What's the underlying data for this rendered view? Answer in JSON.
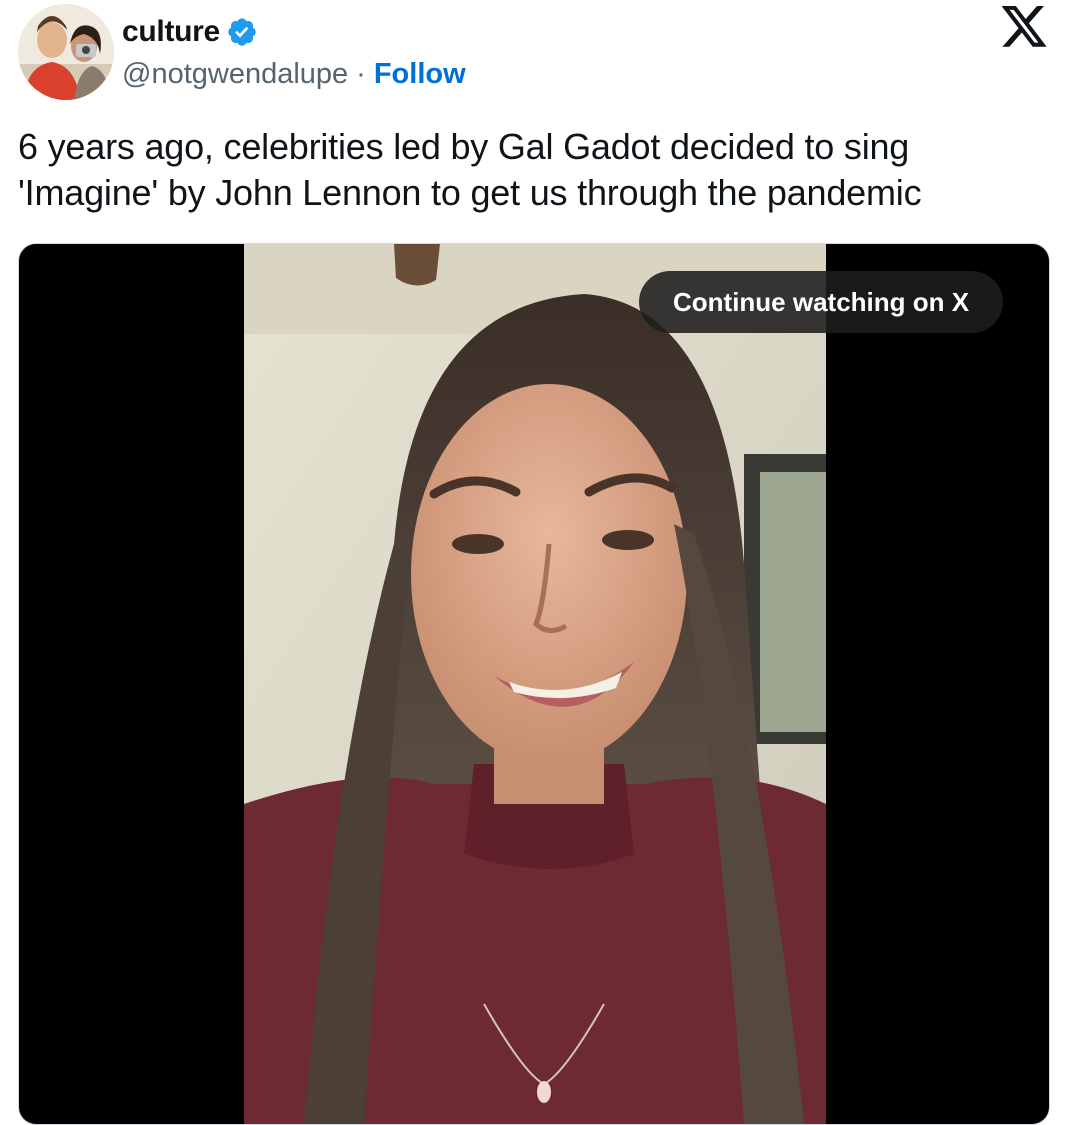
{
  "author": {
    "display_name": "culture",
    "handle": "@notgwendalupe",
    "separator": "·",
    "follow_label": "Follow",
    "verified": true
  },
  "tweet": {
    "text_line1": "6 years ago, celebrities led by Gal Gadot decided to sing",
    "text_line2": "'Imagine' by John Lennon to get us through the pandemic"
  },
  "media": {
    "type": "video",
    "continue_label": "Continue watching on X"
  },
  "icons": {
    "brand": "x-logo-icon",
    "verified": "verified-badge-icon"
  },
  "colors": {
    "link": "#006fd6",
    "verified": "#1d9bf0",
    "text": "#0f1419",
    "secondary": "#536471",
    "overlay_pill": "#1e1e1e"
  }
}
